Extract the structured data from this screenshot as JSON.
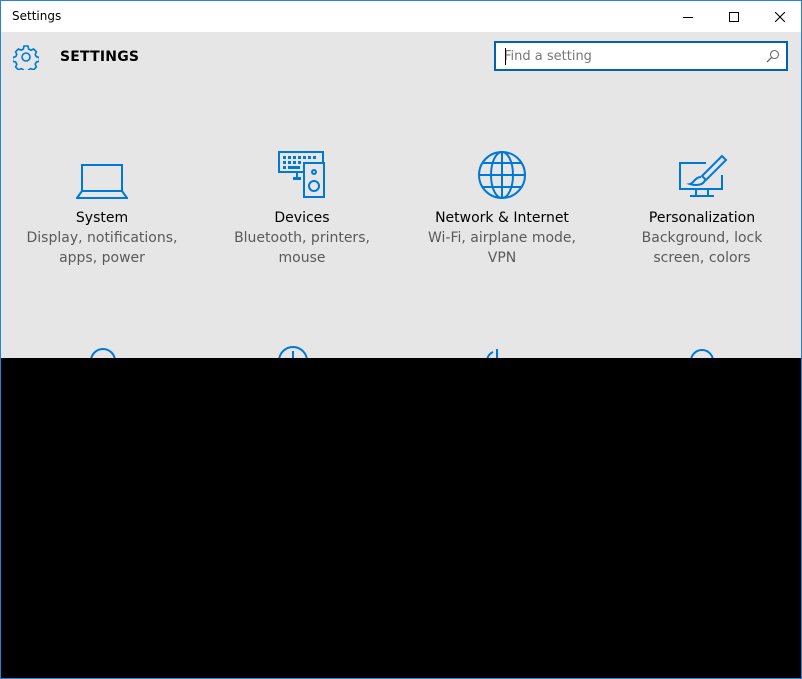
{
  "window": {
    "title": "Settings"
  },
  "header": {
    "title": "SETTINGS",
    "icon": "gear-icon"
  },
  "search": {
    "placeholder": "Find a setting",
    "icon": "search-icon"
  },
  "accent_color": "#0078d7",
  "tiles": [
    {
      "name": "System",
      "desc_line1": "Display, notifications,",
      "desc_line2": "apps, power",
      "icon": "laptop-icon"
    },
    {
      "name": "Devices",
      "desc_line1": "Bluetooth, printers,",
      "desc_line2": "mouse",
      "icon": "devices-icon"
    },
    {
      "name": "Network & Internet",
      "desc_line1": "Wi-Fi, airplane mode,",
      "desc_line2": "VPN",
      "icon": "globe-icon"
    },
    {
      "name": "Personalization",
      "desc_line1": "Background, lock",
      "desc_line2": "screen, colors",
      "icon": "personalization-icon"
    }
  ]
}
